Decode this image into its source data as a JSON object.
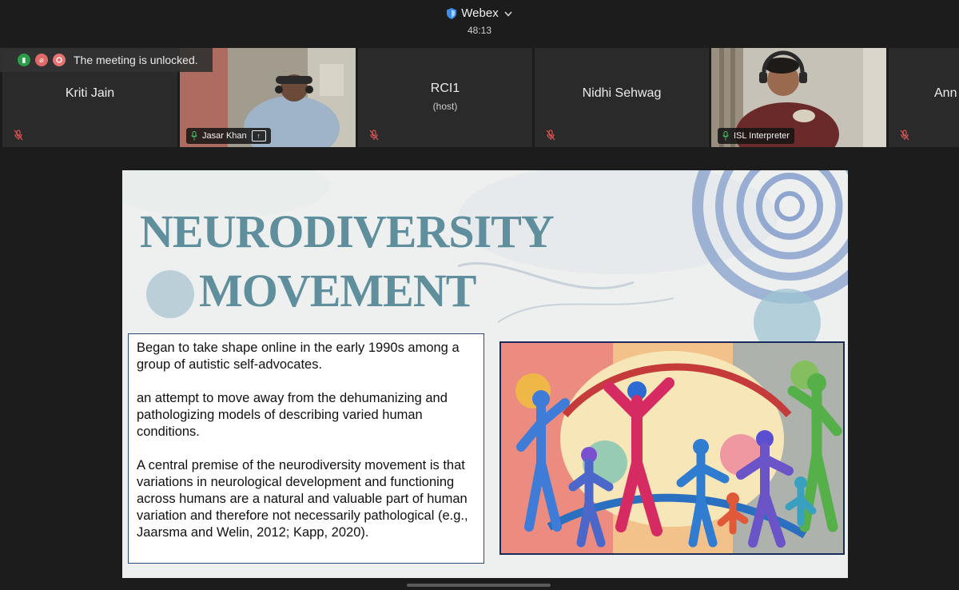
{
  "app": {
    "name": "Webex",
    "timer": "48:13"
  },
  "banner": {
    "text": "The meeting is unlocked."
  },
  "participants": [
    {
      "name": "Kriti Jain",
      "sub": ""
    },
    {
      "name": "Jasar Khan",
      "sub": ""
    },
    {
      "name": "RCI1",
      "sub": "(host)"
    },
    {
      "name": "Nidhi Sehwag",
      "sub": ""
    },
    {
      "name": "ISL Interpreter",
      "sub": ""
    },
    {
      "name": "Ann",
      "sub": ""
    }
  ],
  "slide": {
    "title_line1": "NEURODIVERSITY",
    "title_line2": "MOVEMENT",
    "paragraphs": [
      "Began to take shape online in the early 1990s among a group of autistic self-advocates.",
      "an attempt to move away from the dehumanizing and pathologizing models of describing varied human conditions.",
      "A central premise of the neurodiversity movement is that variations in neurological development and functioning across humans are a natural and valuable part of human variation and therefore not necessarily pathological (e.g., Jaarsma and Welin, 2012; Kapp, 2020)."
    ]
  },
  "icons": {
    "app_shield": "shield-icon",
    "dropdown": "chevron-down-icon",
    "muted": "mic-off-icon",
    "unmuted": "mic-icon",
    "sharing": "share-screen-icon"
  },
  "colors": {
    "background": "#1c1c1c",
    "tile": "#2a2a2a",
    "muted_red": "#e05555",
    "unmuted_green": "#3fbf5f",
    "slide_title": "#5f8e9c",
    "textbox_border": "#2d4a78"
  }
}
